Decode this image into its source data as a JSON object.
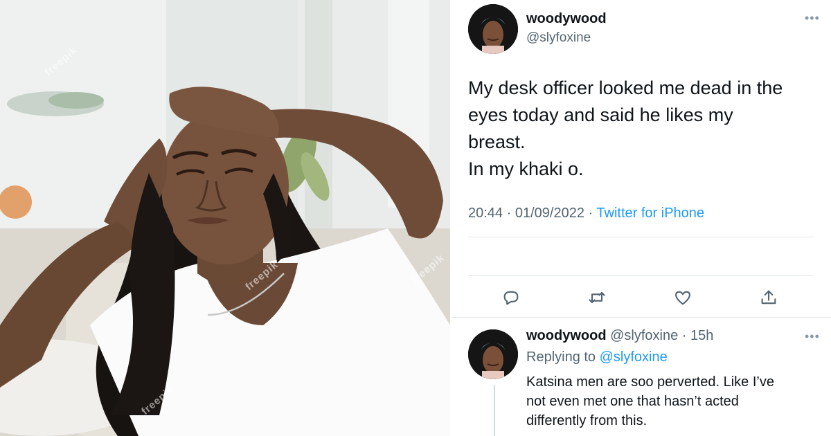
{
  "photo": {
    "alt": "",
    "watermarks": [
      "freepik",
      "freepik",
      "freepik",
      "freepik"
    ]
  },
  "tweet": {
    "display_name": "woodywood",
    "handle": "@slyfoxine",
    "more_icon": "more-horizontal-icon",
    "text_lines": [
      "My desk officer looked me dead in the",
      "eyes today and said he likes my",
      "breast.",
      "In my khaki o."
    ],
    "time": "20:44",
    "separator": "·",
    "date": "01/09/2022",
    "source": "Twitter for iPhone",
    "actions": [
      "reply-icon",
      "retweet-icon",
      "like-icon",
      "share-icon"
    ]
  },
  "reply": {
    "display_name": "woodywood",
    "handle": "@slyfoxine",
    "age": "15h",
    "replying_to_label": "Replying to",
    "replying_to_handle": "@slyfoxine",
    "text_lines": [
      "Katsina men are soo perverted. Like I’ve",
      "not even met one that hasn’t acted",
      "differently from this."
    ]
  },
  "colors": {
    "accent": "#1d9bf0",
    "secondary_text": "#536471",
    "primary_text": "#0f1419",
    "divider": "#e1e5e8"
  }
}
